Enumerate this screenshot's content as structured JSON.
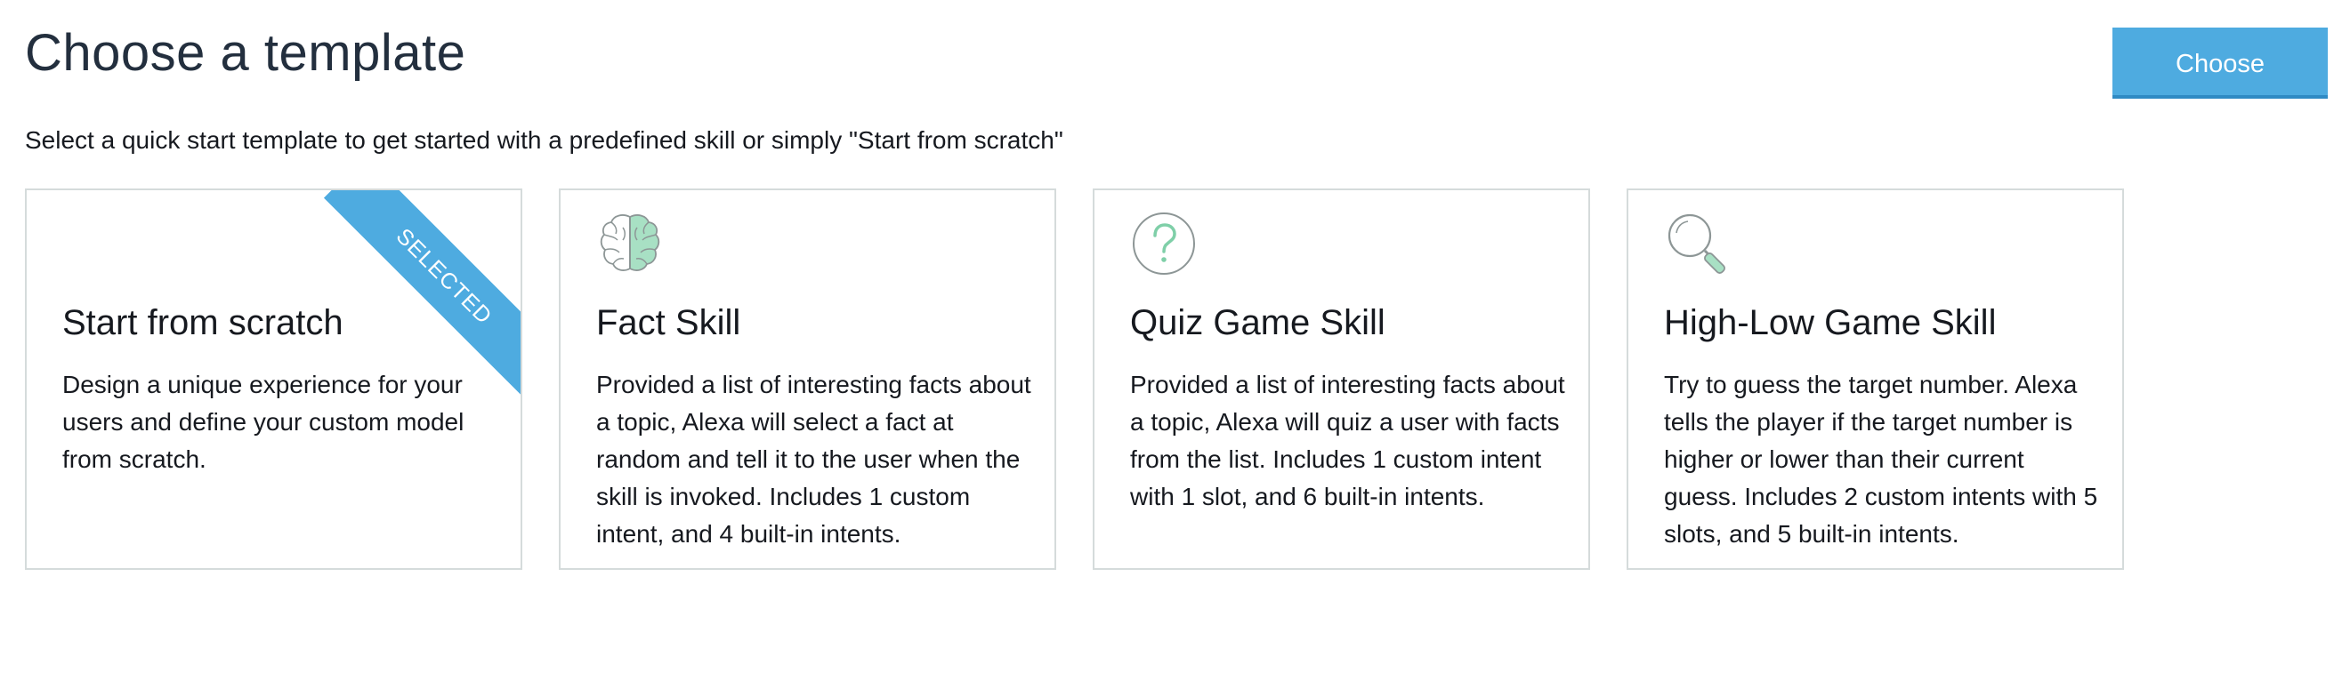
{
  "header": {
    "title": "Choose a template",
    "choose_button": "Choose"
  },
  "subtitle": "Select a quick start template to get started with a predefined skill or simply \"Start from scratch\"",
  "templates": [
    {
      "title": "Start from scratch",
      "description": "Design a unique experience for your users and define your custom model from scratch.",
      "selected": true,
      "badge": "SELECTED",
      "icon": "none"
    },
    {
      "title": "Fact Skill",
      "description": "Provided a list of interesting facts about a topic, Alexa will select a fact at random and tell it to the user when the skill is invoked. Includes 1 custom intent, and 4 built-in intents.",
      "selected": false,
      "icon": "brain-icon"
    },
    {
      "title": "Quiz Game Skill",
      "description": "Provided a list of interesting facts about a topic, Alexa will quiz a user with facts from the list. Includes 1 custom intent with 1 slot, and 6 built-in intents.",
      "selected": false,
      "icon": "question-circle-icon"
    },
    {
      "title": "High-Low Game Skill",
      "description": "Try to guess the target number. Alexa tells the player if the target number is higher or lower than their current guess. Includes 2 custom intents with 5 slots, and 5 built-in intents.",
      "selected": false,
      "icon": "magnifier-icon"
    }
  ],
  "colors": {
    "accent": "#4eabe0",
    "card_border": "#d5dbdb",
    "icon_green": "#a8e0c4",
    "icon_gray": "#8d9696"
  }
}
